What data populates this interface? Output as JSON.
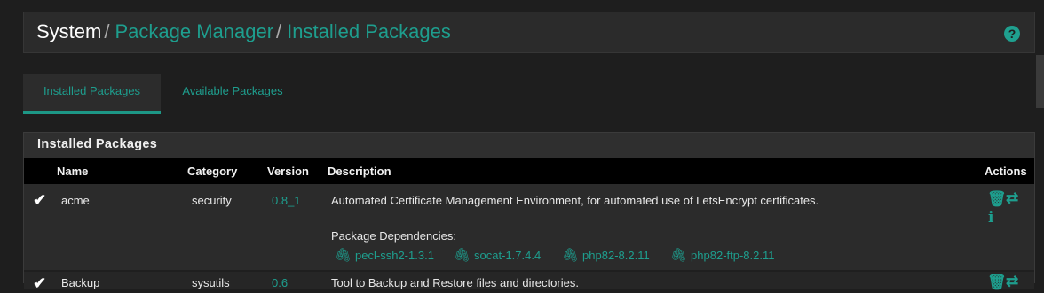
{
  "breadcrumb": {
    "root": "System",
    "separator": "/",
    "items": [
      "Package Manager",
      "Installed Packages"
    ]
  },
  "help_icon": "question-circle-icon",
  "tabs": [
    {
      "label": "Installed Packages",
      "active": true
    },
    {
      "label": "Available Packages",
      "active": false
    }
  ],
  "panel": {
    "title": "Installed Packages",
    "columns": [
      "Name",
      "Category",
      "Version",
      "Description",
      "Actions"
    ],
    "rows": [
      {
        "status_icon": "check-icon",
        "name": "acme",
        "category": "security",
        "version": "0.8_1",
        "description": "Automated Certificate Management Environment, for automated use of LetsEncrypt certificates.",
        "dependencies_label": "Package Dependencies:",
        "dependencies": [
          "pecl-ssh2-1.3.1",
          "socat-1.7.4.4",
          "php82-8.2.11",
          "php82-ftp-8.2.11"
        ],
        "actions": [
          "trash-icon",
          "reinstall-icon",
          "info-icon"
        ]
      },
      {
        "status_icon": "check-icon",
        "name": "Backup",
        "category": "sysutils",
        "version": "0.6",
        "description": "Tool to Backup and Restore files and directories."
      }
    ]
  },
  "colors": {
    "accent": "#1e9e8e",
    "background": "#1e1e1e",
    "panel": "#2b2b2b",
    "table_header": "#000000"
  }
}
